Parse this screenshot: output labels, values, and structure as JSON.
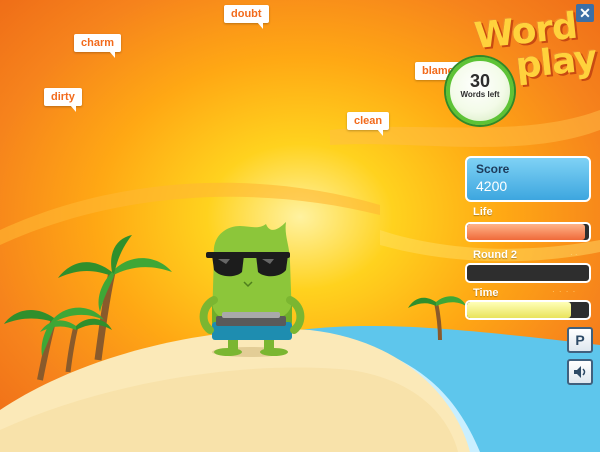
{
  "game": {
    "logo_line1": "Word",
    "logo_line2": "play",
    "words_left_count": "30",
    "words_left_label": "Words left",
    "close_label": "✕"
  },
  "falling_words": [
    "doubt",
    "charm",
    "blame",
    "dirty",
    "clean"
  ],
  "hud": {
    "score_label": "Score",
    "score_value": "4200",
    "life_label": "Life",
    "life_level": 0.97,
    "round_label": "Round 2",
    "round_progress": 0.0,
    "time_label": "Time",
    "time_level": 0.85,
    "pause_label": "P",
    "sound_icon": "speaker-icon"
  },
  "colors": {
    "sky_orange": "#f6831c",
    "word_text": "#f26a1b",
    "score_blue": "#3da6df",
    "life_fill": "#f06a3a",
    "time_fill": "#e9e35c",
    "sea": "#5ec6ec",
    "sand": "#fbe9b8",
    "character_green": "#8cc63a"
  }
}
